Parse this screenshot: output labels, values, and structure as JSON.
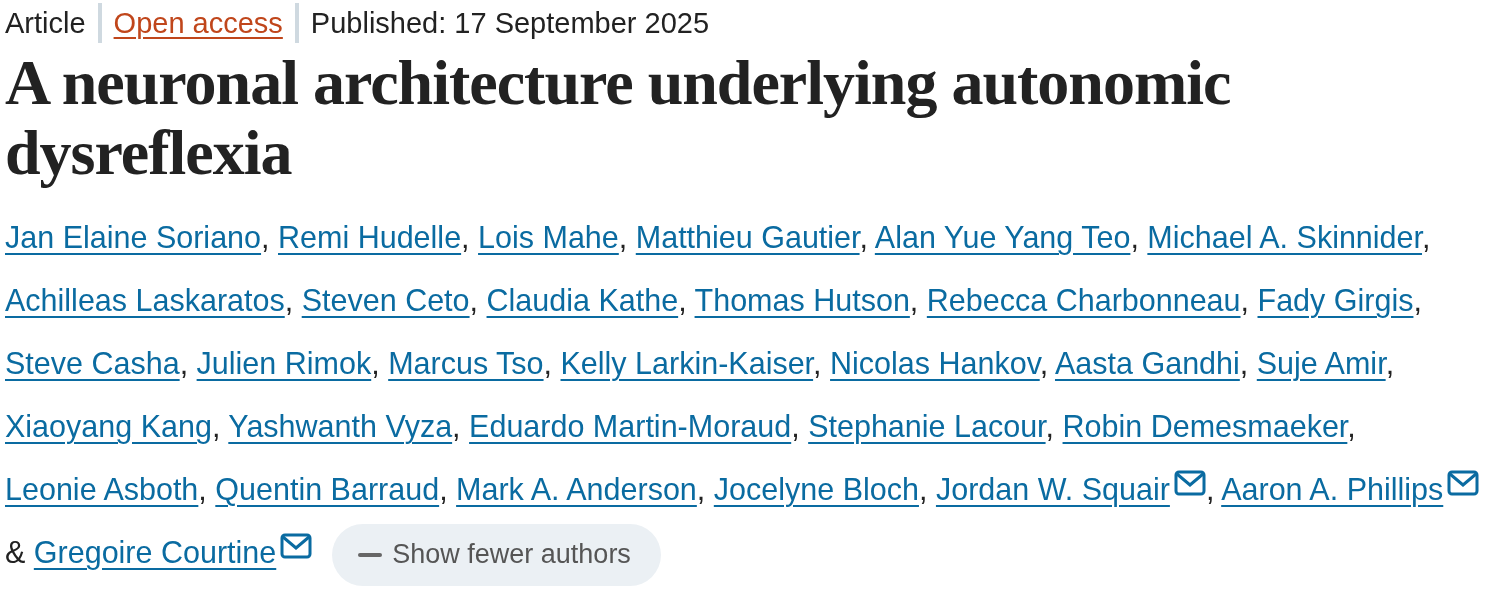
{
  "meta": [
    {
      "kind": "type",
      "text": "Article"
    },
    {
      "kind": "link",
      "text": "Open access"
    },
    {
      "kind": "date",
      "text": "Published: 17 September 2025"
    }
  ],
  "title": "A neuronal architecture underlying autonomic dysreflexia",
  "authors": [
    {
      "name": "Jan Elaine Soriano",
      "corresponding": false,
      "after": ","
    },
    {
      "name": "Remi Hudelle",
      "corresponding": false,
      "after": ","
    },
    {
      "name": "Lois Mahe",
      "corresponding": false,
      "after": ","
    },
    {
      "name": "Matthieu Gautier",
      "corresponding": false,
      "after": ","
    },
    {
      "name": "Alan Yue Yang Teo",
      "corresponding": false,
      "after": ","
    },
    {
      "name": "Michael A. Skinnider",
      "corresponding": false,
      "after": ","
    },
    {
      "name": "Achilleas Laskaratos",
      "corresponding": false,
      "after": ","
    },
    {
      "name": "Steven Ceto",
      "corresponding": false,
      "after": ","
    },
    {
      "name": "Claudia Kathe",
      "corresponding": false,
      "after": ","
    },
    {
      "name": "Thomas Hutson",
      "corresponding": false,
      "after": ","
    },
    {
      "name": "Rebecca Charbonneau",
      "corresponding": false,
      "after": ","
    },
    {
      "name": "Fady Girgis",
      "corresponding": false,
      "after": ","
    },
    {
      "name": "Steve Casha",
      "corresponding": false,
      "after": ","
    },
    {
      "name": "Julien Rimok",
      "corresponding": false,
      "after": ","
    },
    {
      "name": "Marcus Tso",
      "corresponding": false,
      "after": ","
    },
    {
      "name": "Kelly Larkin-Kaiser",
      "corresponding": false,
      "after": ","
    },
    {
      "name": "Nicolas Hankov",
      "corresponding": false,
      "after": ","
    },
    {
      "name": "Aasta Gandhi",
      "corresponding": false,
      "after": ","
    },
    {
      "name": "Suje Amir",
      "corresponding": false,
      "after": ","
    },
    {
      "name": "Xiaoyang Kang",
      "corresponding": false,
      "after": ","
    },
    {
      "name": "Yashwanth Vyza",
      "corresponding": false,
      "after": ","
    },
    {
      "name": "Eduardo Martin-Moraud",
      "corresponding": false,
      "after": ","
    },
    {
      "name": "Stephanie Lacour",
      "corresponding": false,
      "after": ","
    },
    {
      "name": "Robin Demesmaeker",
      "corresponding": false,
      "after": ","
    },
    {
      "name": "Leonie Asboth",
      "corresponding": false,
      "after": ","
    },
    {
      "name": "Quentin Barraud",
      "corresponding": false,
      "after": ","
    },
    {
      "name": "Mark A. Anderson",
      "corresponding": false,
      "after": ","
    },
    {
      "name": "Jocelyne Bloch",
      "corresponding": false,
      "after": ","
    },
    {
      "name": "Jordan W. Squair",
      "corresponding": true,
      "after": ","
    },
    {
      "name": "Aaron A. Phillips",
      "corresponding": true,
      "after": "&"
    },
    {
      "name": "Gregoire Courtine",
      "corresponding": true
    }
  ],
  "toggle_button": {
    "label": "Show fewer authors"
  }
}
